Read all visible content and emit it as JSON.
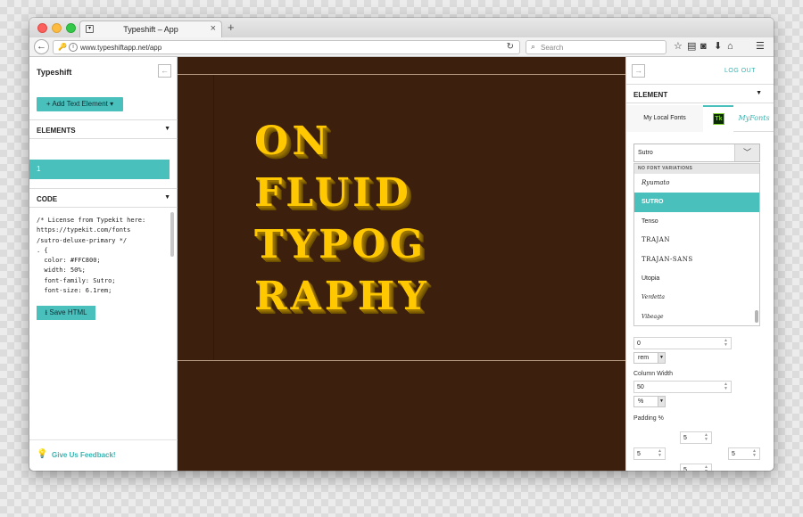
{
  "browser": {
    "tab_title": "Typeshift – App",
    "new_tab": "+",
    "url": "www.typeshiftapp.net/app",
    "search_placeholder": "Search"
  },
  "left_panel": {
    "title": "Typeshift",
    "collapse": "←",
    "add_button": "+ Add Text Element ▾",
    "elements_header": "ELEMENTS",
    "element_item": "1",
    "code_header": "CODE",
    "code": "/* License from Typekit here:\nhttps://typekit.com/fonts\n/sutro-deluxe-primary */\n. {\n  color: #FFC800;\n  width: 50%;\n  font-family: Sutro;\n  font-size: 6.1rem;",
    "save_button": "⭳ Save HTML",
    "feedback": "Give Us Feedback!"
  },
  "canvas": {
    "lines": [
      "ON",
      "FLUID",
      "TYPOG",
      "RAPHY"
    ],
    "text_color": "#FFC800",
    "background": "#3d1f0d"
  },
  "right_panel": {
    "expand": "→",
    "logout": "LOG OUT",
    "element_header": "ELEMENT",
    "font_tabs": {
      "local": "My Local Fonts",
      "typekit": "Tk",
      "myfonts": "MyFonts"
    },
    "font_select_value": "Sutro",
    "dropdown_group": "NO FONT VARIATIONS",
    "font_options": [
      "Ryumato",
      "SUTRO",
      "Tenso",
      "TRAJAN",
      "TRAJAN-SANS",
      "Utopia",
      "Verdetta",
      "Vibeage"
    ],
    "selected_font": "SUTRO",
    "top_value": "0",
    "top_unit": "rem",
    "column_width_label": "Column Width",
    "column_width_value": "50",
    "column_width_unit": "%",
    "padding_label": "Padding %",
    "padding_top": "5",
    "padding_left": "5",
    "padding_right": "5",
    "padding_bottom": "5"
  },
  "colors": {
    "accent": "#4ac0bd",
    "canvas_bg": "#3d1f0d",
    "headline": "#ffc800"
  }
}
